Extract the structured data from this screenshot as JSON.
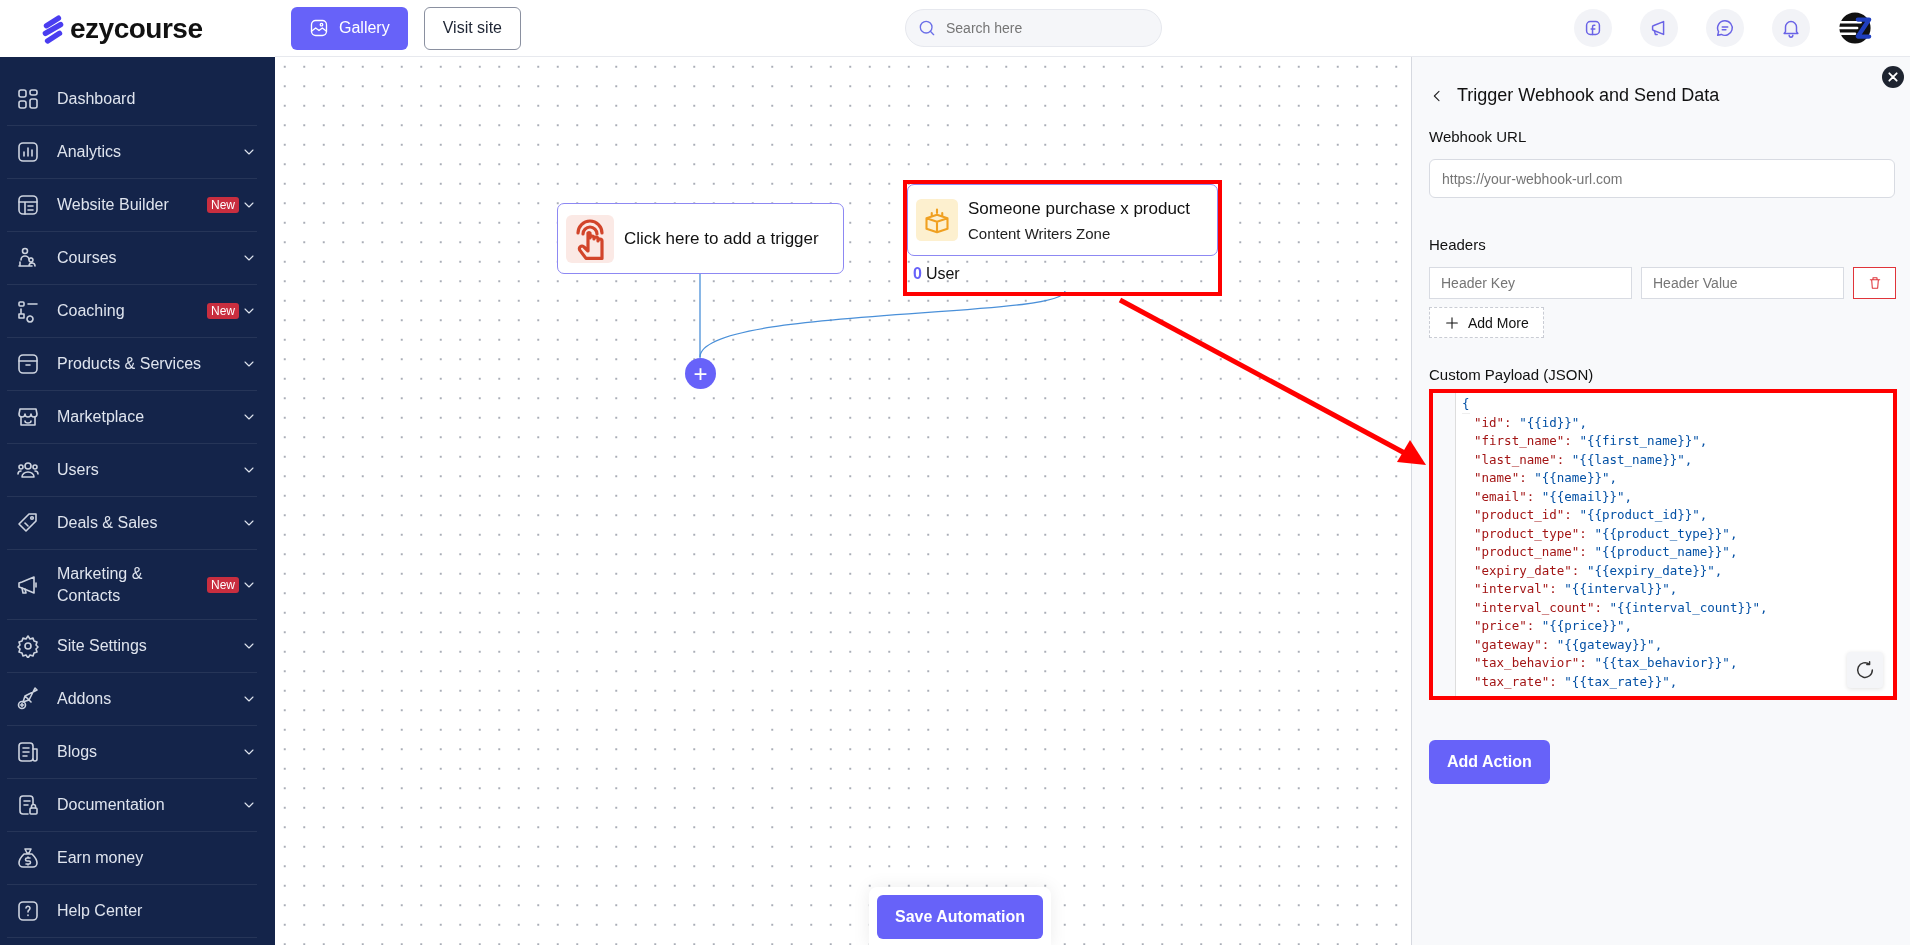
{
  "brand": {
    "name": "ezycourse"
  },
  "topbar": {
    "buttons": [
      {
        "label": "Gallery",
        "kind": "primary"
      },
      {
        "label": "Visit site",
        "kind": "outline"
      }
    ],
    "search": {
      "placeholder": "Search here"
    }
  },
  "sidebar": {
    "items": [
      {
        "label": "Dashboard",
        "expandable": false
      },
      {
        "label": "Analytics",
        "expandable": true
      },
      {
        "label": "Website Builder",
        "badge": "New",
        "expandable": true
      },
      {
        "label": "Courses",
        "expandable": true
      },
      {
        "label": "Coaching",
        "badge": "New",
        "expandable": true
      },
      {
        "label": "Products & Services",
        "expandable": true
      },
      {
        "label": "Marketplace",
        "expandable": true
      },
      {
        "label": "Users",
        "expandable": true
      },
      {
        "label": "Deals & Sales",
        "expandable": true
      },
      {
        "label": "Marketing & Contacts",
        "badge": "New",
        "expandable": true
      },
      {
        "label": "Site Settings",
        "expandable": true
      },
      {
        "label": "Addons",
        "expandable": true
      },
      {
        "label": "Blogs",
        "expandable": true
      },
      {
        "label": "Documentation",
        "expandable": true
      },
      {
        "label": "Earn money",
        "expandable": false
      },
      {
        "label": "Help Center",
        "expandable": false
      }
    ]
  },
  "canvas": {
    "trigger_node": {
      "label": "Click here to add a trigger"
    },
    "event_node": {
      "title": "Someone purchase x product",
      "subtitle": "Content Writers Zone",
      "count": "0",
      "count_label": "User",
      "highlighted": true
    },
    "add_step": {
      "label": "+"
    },
    "save_button": {
      "label": "Save Automation"
    }
  },
  "panel": {
    "title": "Trigger Webhook and Send Data",
    "webhook_url": {
      "label": "Webhook URL",
      "placeholder": "https://your-webhook-url.com"
    },
    "headers": {
      "label": "Headers",
      "rows": [
        {
          "key_placeholder": "Header Key",
          "value_placeholder": "Header Value"
        }
      ],
      "add_button": "Add More"
    },
    "payload": {
      "label": "Custom Payload (JSON)",
      "highlighted": true,
      "lines": [
        {
          "kind": "brace",
          "text": "{"
        },
        {
          "kind": "pair",
          "key": "\"id\":",
          "value": "\"{{id}}\","
        },
        {
          "kind": "pair",
          "key": "\"first_name\":",
          "value": "\"{{first_name}}\","
        },
        {
          "kind": "pair",
          "key": "\"last_name\":",
          "value": "\"{{last_name}}\","
        },
        {
          "kind": "pair",
          "key": "\"name\":",
          "value": "\"{{name}}\","
        },
        {
          "kind": "pair",
          "key": "\"email\":",
          "value": "\"{{email}}\","
        },
        {
          "kind": "pair",
          "key": "\"product_id\":",
          "value": "\"{{product_id}}\","
        },
        {
          "kind": "pair",
          "key": "\"product_type\":",
          "value": "\"{{product_type}}\","
        },
        {
          "kind": "pair",
          "key": "\"product_name\":",
          "value": "\"{{product_name}}\","
        },
        {
          "kind": "pair",
          "key": "\"expiry_date\":",
          "value": "\"{{expiry_date}}\","
        },
        {
          "kind": "pair",
          "key": "\"interval\":",
          "value": "\"{{interval}}\","
        },
        {
          "kind": "pair",
          "key": "\"interval_count\":",
          "value": "\"{{interval_count}}\","
        },
        {
          "kind": "pair",
          "key": "\"price\":",
          "value": "\"{{price}}\","
        },
        {
          "kind": "pair",
          "key": "\"gateway\":",
          "value": "\"{{gateway}}\","
        },
        {
          "kind": "pair",
          "key": "\"tax_behavior\":",
          "value": "\"{{tax_behavior}}\","
        },
        {
          "kind": "pair",
          "key": "\"tax_rate\":",
          "value": "\"{{tax_rate}}\","
        }
      ]
    },
    "action_button": {
      "label": "Add Action"
    }
  }
}
